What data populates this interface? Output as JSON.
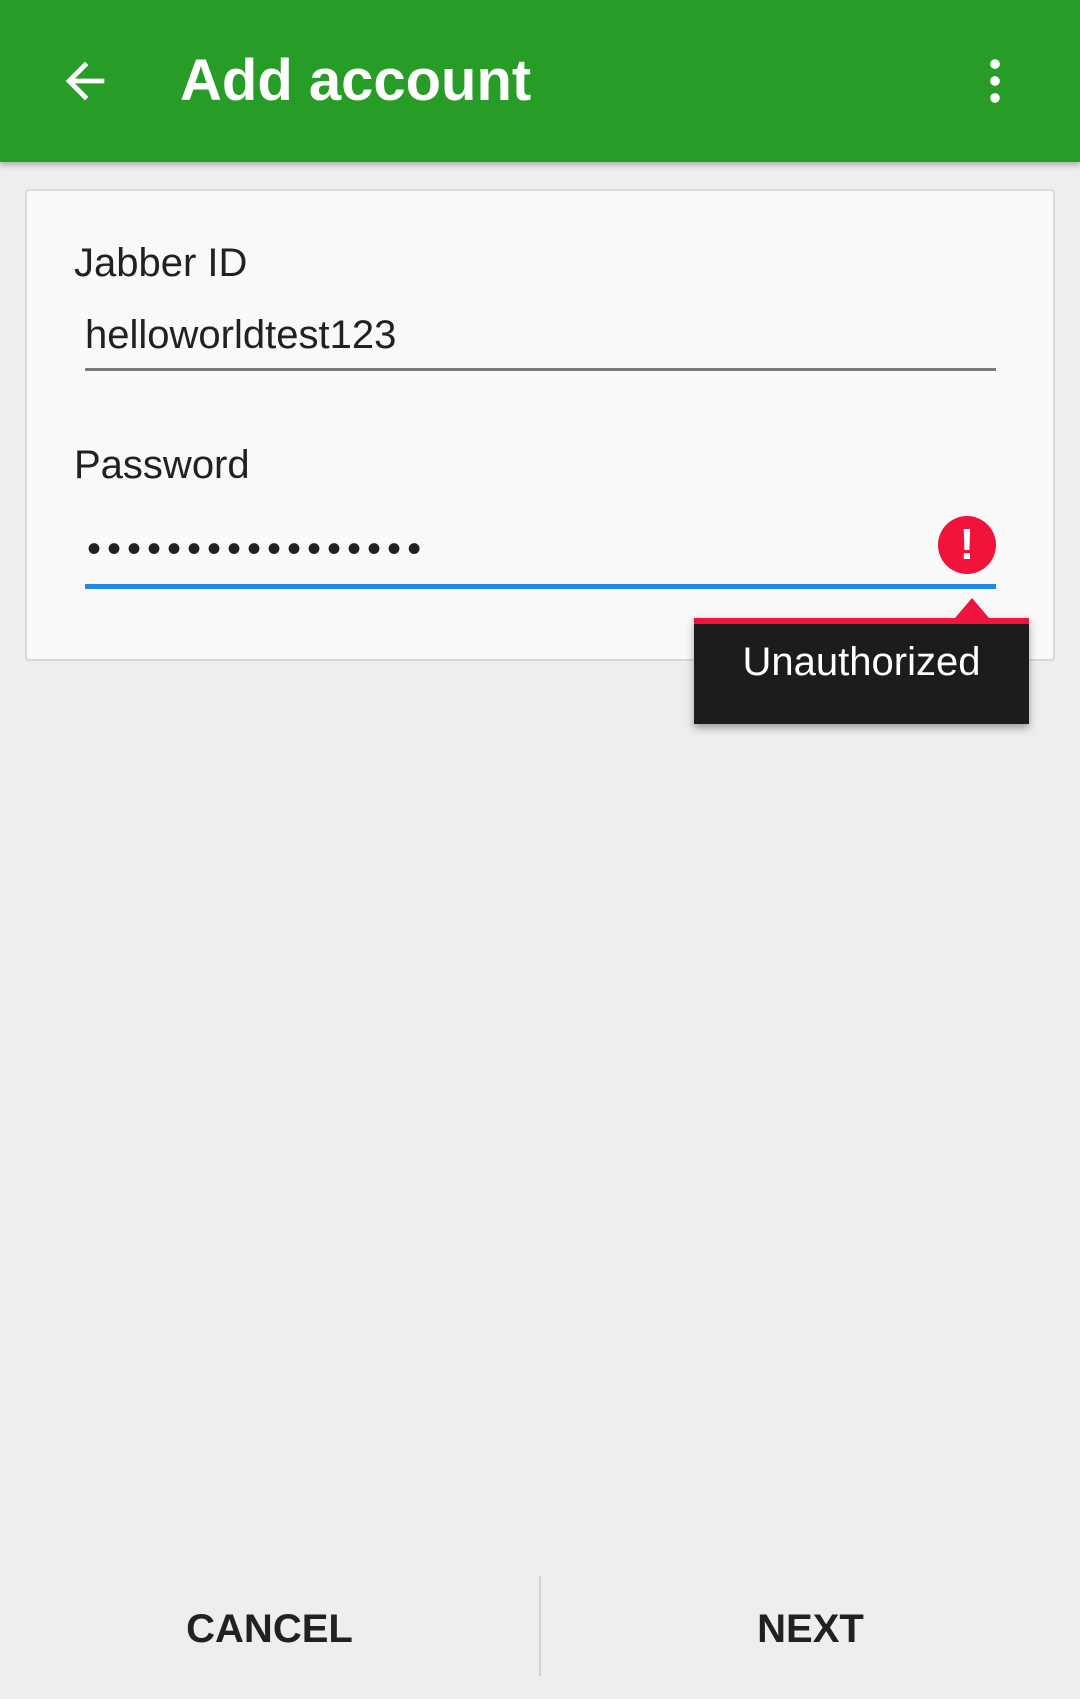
{
  "appbar": {
    "title": "Add account",
    "back_icon": "arrow-left-icon",
    "overflow_icon": "more-vertical-icon",
    "color": "#279c27"
  },
  "form": {
    "jabber_id": {
      "label": "Jabber ID",
      "value": "helloworldtest123"
    },
    "password": {
      "label": "Password",
      "masked_value": "•••••••••••••••••",
      "error_icon": "error-alert-icon",
      "error_message": "Unauthorized"
    }
  },
  "buttons": {
    "cancel": "CANCEL",
    "next": "NEXT"
  },
  "colors": {
    "accent_blue": "#1e88e5",
    "error_red": "#f0143c"
  }
}
